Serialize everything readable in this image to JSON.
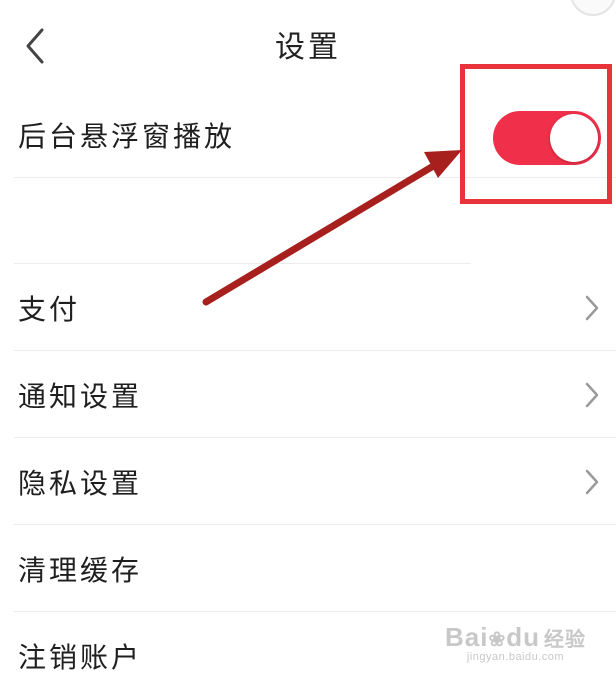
{
  "header": {
    "title": "设置",
    "back_icon": "chevron-left-icon"
  },
  "settings": {
    "floating_playback": {
      "label": "后台悬浮窗播放",
      "enabled": true
    },
    "payment": {
      "label": "支付"
    },
    "notification": {
      "label": "通知设置"
    },
    "privacy": {
      "label": "隐私设置"
    },
    "clear_cache": {
      "label": "清理缓存"
    },
    "cancel_account": {
      "label": "注销账户"
    }
  },
  "watermark": {
    "brand_a": "Bai",
    "brand_b": "du",
    "brand_c": "经验",
    "url": "jingyan.baidu.com"
  },
  "colors": {
    "toggle_on": "#f0304a",
    "highlight_box": "#e8333a",
    "arrow": "#a8201d",
    "divider": "#ececec",
    "chevron": "#9a9a9a"
  }
}
